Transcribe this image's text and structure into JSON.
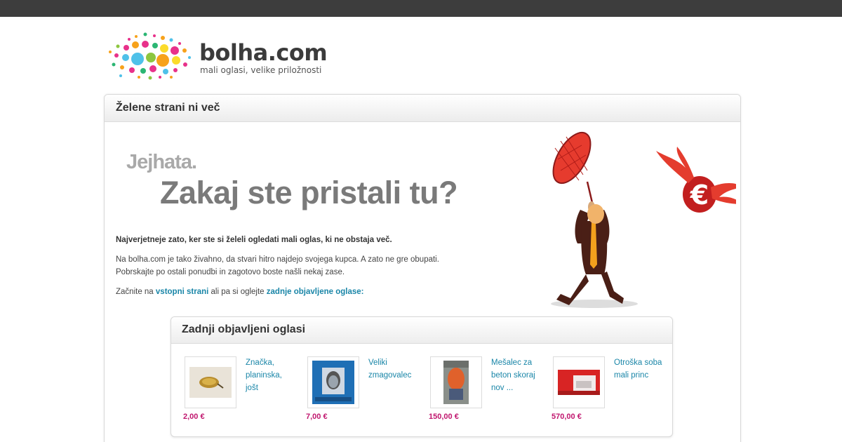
{
  "site": {
    "logo_title": "bolha.com",
    "logo_tagline": "mali oglasi, velike priložnosti"
  },
  "panel": {
    "title": "Želene strani ni več",
    "jejhata": "Jejhata.",
    "headline": "Zakaj ste pristali tu?",
    "paragraph1": "Najverjetneje zato, ker ste si želeli ogledati mali oglas, ki ne obstaja več.",
    "paragraph2_line1": "Na bolha.com je tako živahno, da stvari hitro najdejo svojega kupca. A zato ne gre obupati.",
    "paragraph2_line2": "Pobrskajte po ostali ponudbi in zagotovo boste našli nekaj zase.",
    "p3_prefix": "Začnite na ",
    "p3_link1": "vstopni strani",
    "p3_middle": " ali pa si oglejte ",
    "p3_link2": "zadnje objavljene oglase:"
  },
  "recent": {
    "title": "Zadnji objavljeni oglasi",
    "items": [
      {
        "title": "Značka, planinska, jošt",
        "price": "2,00 €"
      },
      {
        "title": "Veliki zmagovalec",
        "price": "7,00 €"
      },
      {
        "title": "Mešalec za beton skoraj nov ...",
        "price": "150,00 €"
      },
      {
        "title": "Otroška soba mali princ",
        "price": "570,00 €"
      }
    ]
  },
  "colors": {
    "topbar": "#3d3d3d",
    "link": "#1a86a8",
    "price": "#c0166e",
    "headline": "#7a7a7a"
  }
}
